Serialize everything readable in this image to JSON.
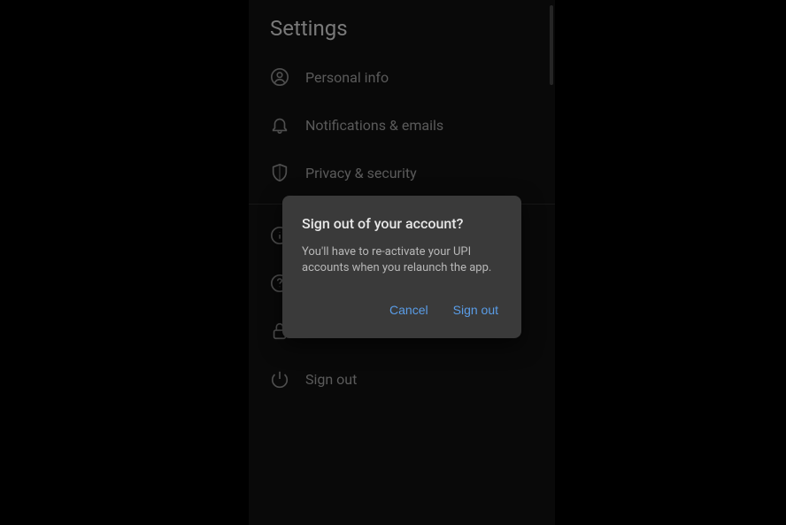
{
  "header": {
    "title": "Settings"
  },
  "menu": {
    "items": [
      {
        "label": "Personal info"
      },
      {
        "label": "Notifications & emails"
      },
      {
        "label": "Privacy & security"
      }
    ],
    "secondary": [
      {
        "label": "About"
      },
      {
        "label": "Help"
      },
      {
        "label": "Lock"
      },
      {
        "label": "Sign out"
      }
    ]
  },
  "modal": {
    "title": "Sign out of your account?",
    "body": "You'll have to re-activate your UPI accounts when you relaunch the app.",
    "cancel": "Cancel",
    "confirm": "Sign out"
  }
}
